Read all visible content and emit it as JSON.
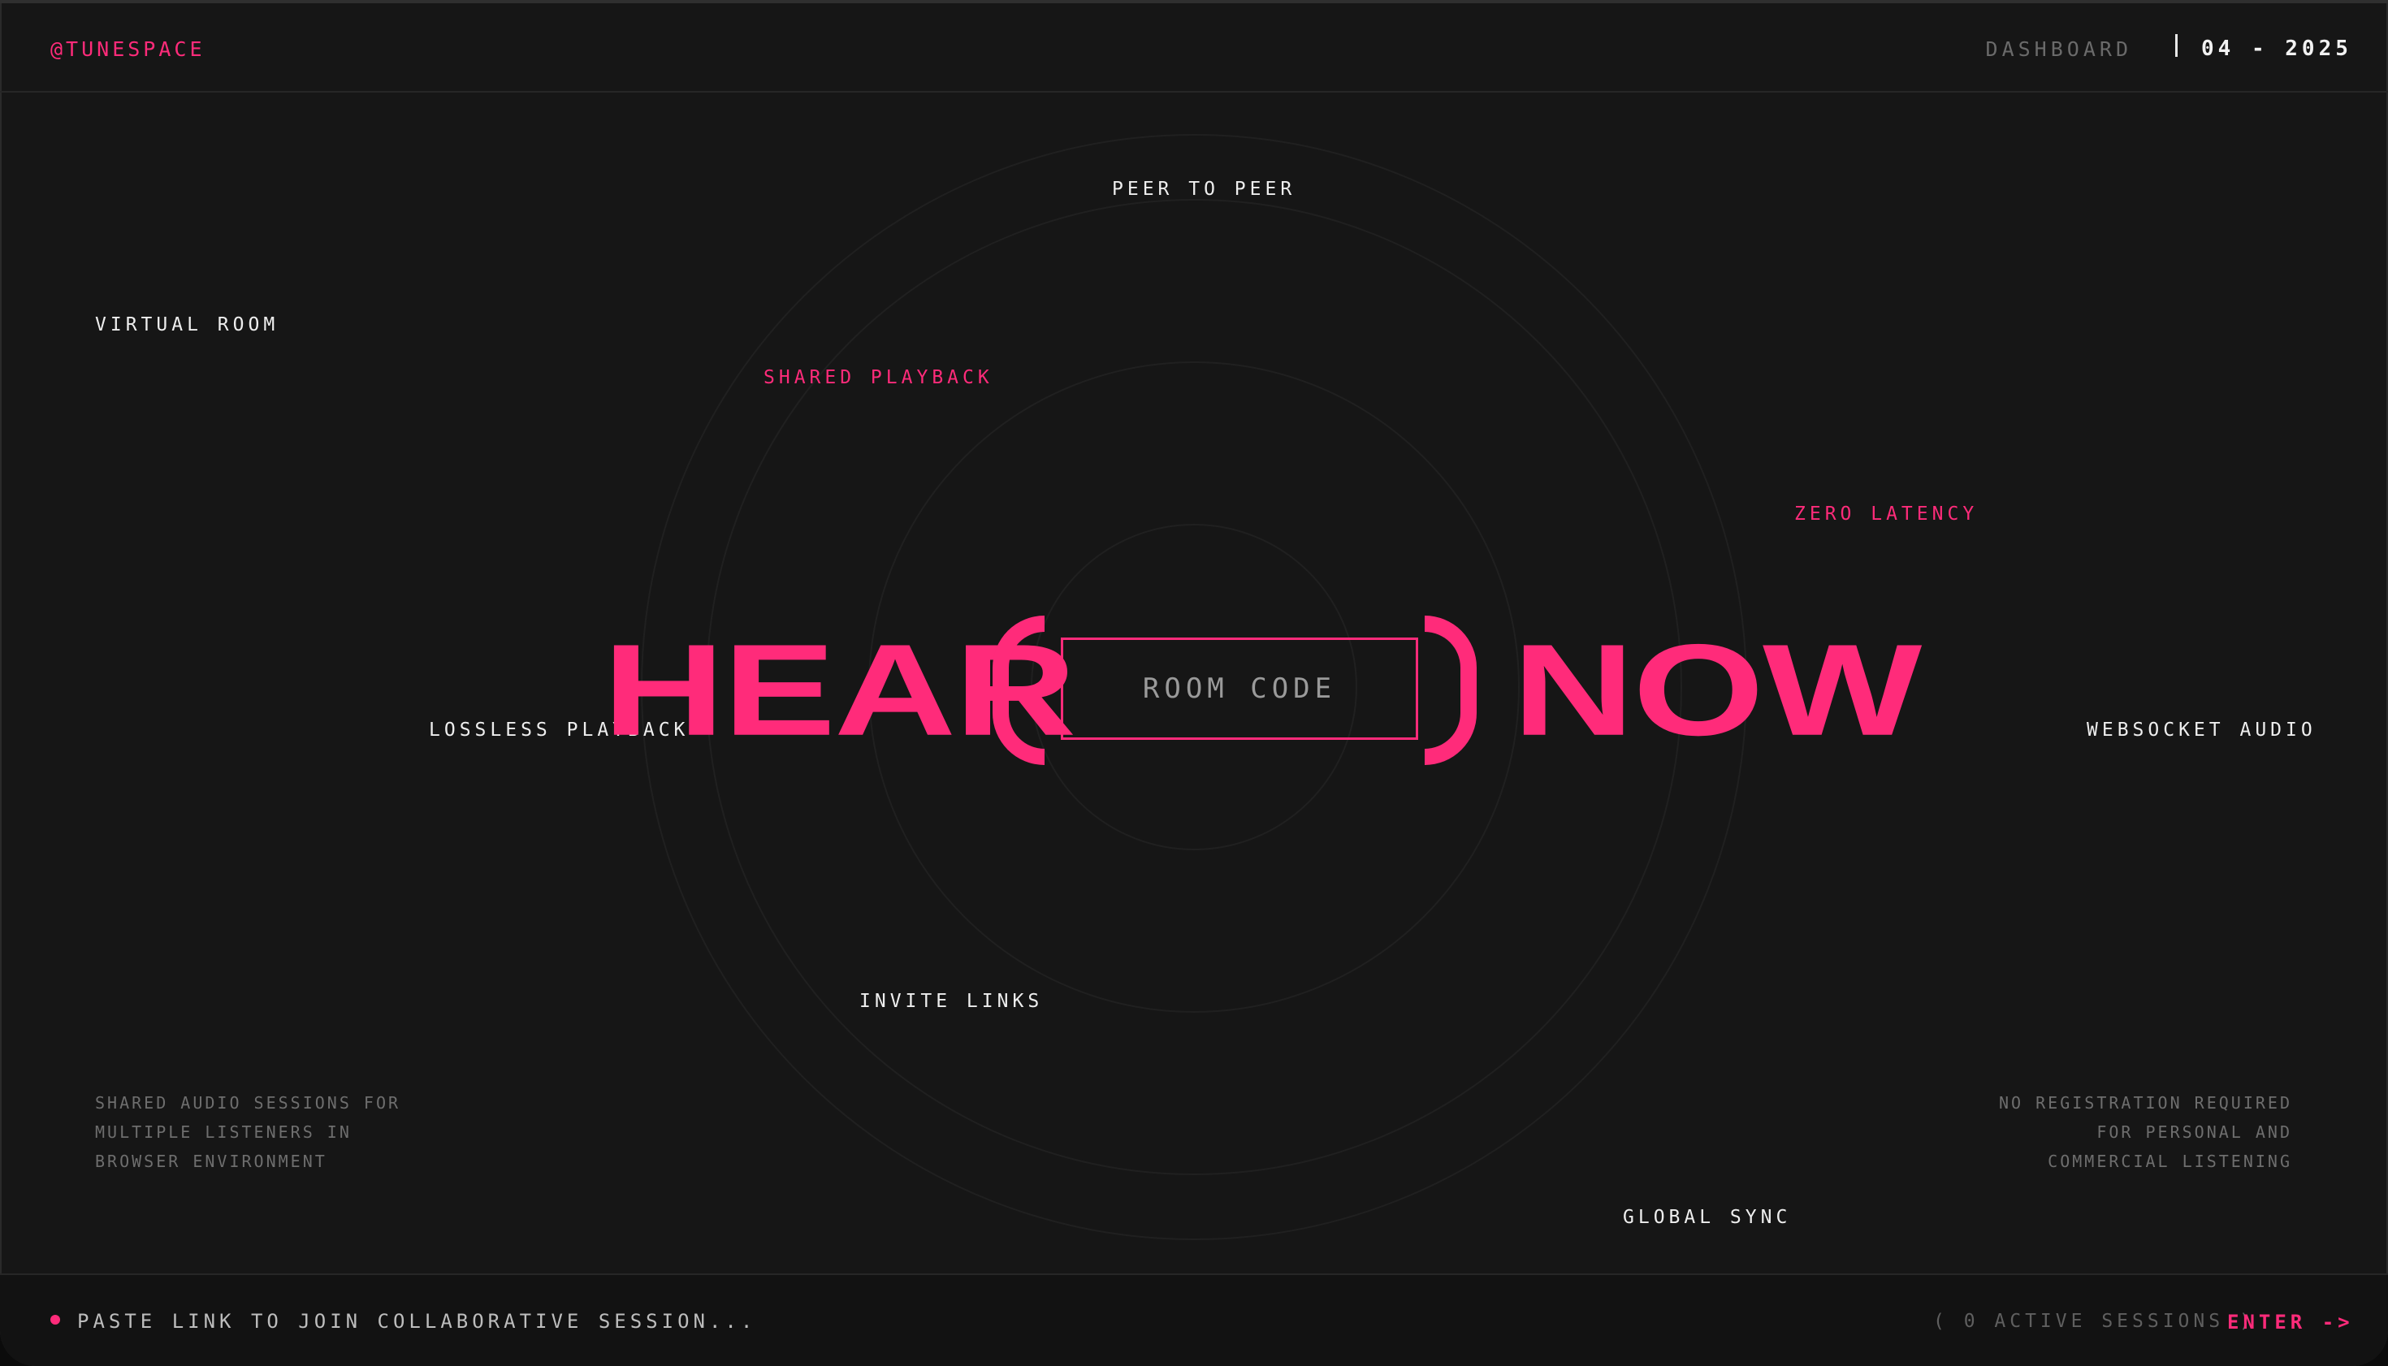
{
  "header": {
    "brand": "@TUNESPACE",
    "nav_dashboard": "DASHBOARD",
    "date": "04 - 2025"
  },
  "tags": {
    "peer_to_peer": "PEER TO PEER",
    "virtual_room": "VIRTUAL ROOM",
    "shared_playback": "SHARED PLAYBACK",
    "zero_latency": "ZERO LATENCY",
    "lossless_playback": "LOSSLESS PLAYBACK",
    "websocket_audio": "WEBSOCKET AUDIO",
    "invite_links": "INVITE LINKS",
    "global_sync": "GLOBAL SYNC"
  },
  "hero": {
    "word_left": "HEAR",
    "word_right": "NOW",
    "room_code_placeholder": "ROOM CODE"
  },
  "descriptions": {
    "left": [
      "SHARED AUDIO SESSIONS FOR",
      "MULTIPLE LISTENERS IN",
      "BROWSER ENVIRONMENT"
    ],
    "right": [
      "NO REGISTRATION REQUIRED",
      "FOR PERSONAL AND",
      "COMMERCIAL LISTENING"
    ]
  },
  "footer": {
    "link_placeholder": "PASTE LINK TO JOIN COLLABORATIVE SESSION...",
    "active_sessions": "( 0 ACTIVE SESSIONS )",
    "enter_label": "ENTER ->"
  },
  "colors": {
    "accent": "#ff2b7a",
    "background": "#161616",
    "ring": "#222222"
  }
}
